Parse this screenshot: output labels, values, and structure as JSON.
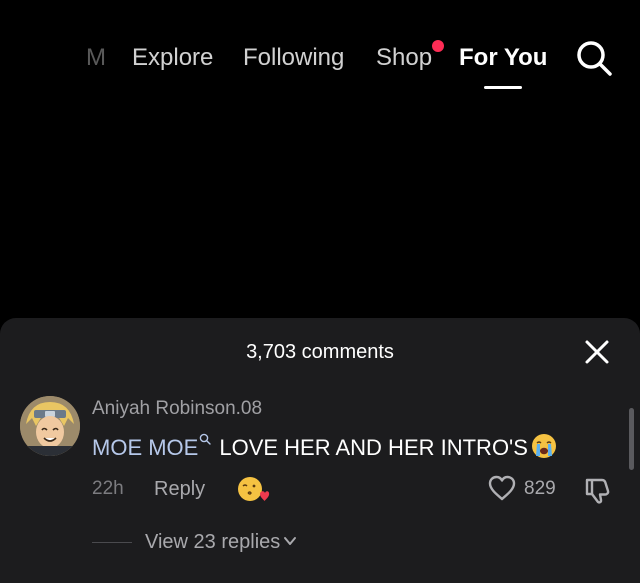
{
  "top_nav": {
    "tabs": [
      {
        "label": "M"
      },
      {
        "label": "Explore"
      },
      {
        "label": "Following"
      },
      {
        "label": "Shop"
      },
      {
        "label": "For You"
      }
    ],
    "active_tab": "For You",
    "shop_dot_color": "#fe2c55",
    "search_icon": "search-icon"
  },
  "comments": {
    "count_label": "3,703 comments",
    "close_icon": "close-icon",
    "items": [
      {
        "username": "Aniyah Robinson.08",
        "mention": "MOE MOE",
        "text": "LOVE HER AND HER INTRO'S",
        "emoji": "loudly-crying-face",
        "timestamp": "22h",
        "reply_label": "Reply",
        "like_count": "829",
        "view_replies_label": "View 23 replies"
      }
    ]
  },
  "colors": {
    "background": "#000000",
    "sheet": "#1c1c1e",
    "mention": "#b6c8ea",
    "accent": "#fe2c55"
  }
}
